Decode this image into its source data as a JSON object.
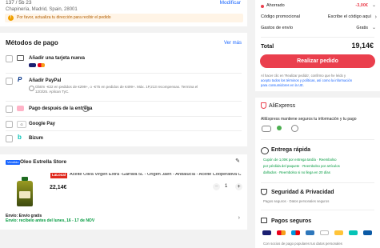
{
  "address": {
    "line1": "137 / 5b 23",
    "line2": "Chapinería, Madrid, Spain, 28001",
    "modify_label": "Modificar",
    "warning": "Por favor, actualiza tu dirección para recibir el pedido"
  },
  "payment": {
    "title": "Métodos de pago",
    "see_more": "Ver más",
    "methods": [
      {
        "label": "Añadir una tarjeta nueva",
        "icon": "credit-card-icon"
      },
      {
        "label": "Añadir PayPal",
        "icon": "paypal-icon"
      },
      {
        "label": "Pago después de la entrega",
        "icon": "klarna-icon"
      },
      {
        "label": "Google Pay",
        "icon": "google-pay-icon"
      },
      {
        "label": "Bizum",
        "icon": "bizum-icon"
      }
    ],
    "paypal_promo": "Obtén -€22 en pedidos de €299+, o -€75 en pedidos de €499+. Máx. 1P,213 recompensas. Termina el 12/3/25. Aplican TyC."
  },
  "store": {
    "badge": "Vendido",
    "name": "Oleo Estrella Store",
    "product_brand": "LaLocal",
    "product_title": "Aceite Oliva Virgen Extra -Garrafa 5L - Origen Jaén - Andalucía - Aceite Cooperativa C",
    "price": "22,14€",
    "quantity": "1",
    "shipping_label": "Envío: Envío gratis",
    "delivery_estimate": "Envío: recibelo antes del lunes, 16 - 17 de NOV"
  },
  "summary": {
    "savings_label": "Ahorrado",
    "savings_value": "-3,00€",
    "promo_label": "Código promocional",
    "promo_action": "Escribe el código aquí",
    "shipping_label": "Gastos de envío",
    "shipping_value": "Gratis",
    "total_label": "Total",
    "total_value": "19,14€",
    "order_button": "Realizar pedido",
    "legal_line1": "Al hacer clic en 'Realizar pedido', confirmo que he leído y",
    "legal_line2": "acepto todos los términos y políticas, así como la información",
    "legal_line3": "para consumidores en la UE."
  },
  "trust": {
    "brand": "AliExpress",
    "message": "AliExpress mantiene seguros tu información y tu pago",
    "fast_title": "Entrega rápida",
    "fast_line1": "Cupón de 1,00€ por entrega tardía  ·  Reembolso",
    "fast_line2": "por pérdida del paquete  ·  Reembolso por artículos",
    "fast_line3": "dañados  ·  Reembolso si no llega en 20 días",
    "privacy_title": "Seguridad & Privacidad",
    "privacy_text": "Pagos seguros · Datos personales seguros",
    "secure_title": "Pagos seguros",
    "secure_text": "Con socios de pago populares tus datos personales"
  },
  "colors": {
    "accent_red": "#ea3f4d",
    "link_blue": "#1a66ff",
    "promo_green": "#009a3e",
    "warning_orange": "#e67800"
  }
}
